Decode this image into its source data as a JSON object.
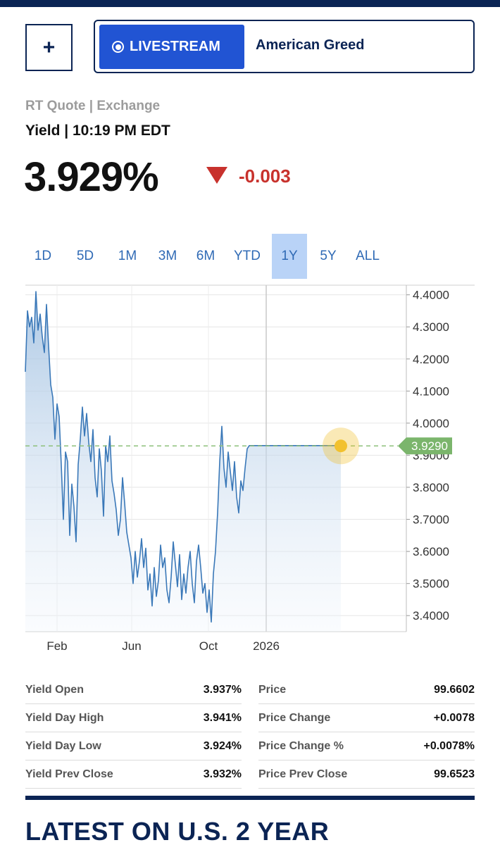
{
  "header": {
    "plus_label": "+",
    "livestream_label": "LIVESTREAM",
    "show_name": "American Greed"
  },
  "quote": {
    "source": "RT Quote | Exchange",
    "type_time": "Yield | 10:19 PM EDT",
    "last": "3.929%",
    "change": "-0.003",
    "direction": "down",
    "down_color": "#c8322d"
  },
  "tabs": [
    {
      "label": "1D",
      "active": false
    },
    {
      "label": "5D",
      "active": false
    },
    {
      "label": "1M",
      "active": false
    },
    {
      "label": "3M",
      "active": false
    },
    {
      "label": "6M",
      "active": false
    },
    {
      "label": "YTD",
      "active": false
    },
    {
      "label": "1Y",
      "active": true
    },
    {
      "label": "5Y",
      "active": false
    },
    {
      "label": "ALL",
      "active": false
    }
  ],
  "chart_data": {
    "type": "area",
    "x_tick_labels": [
      "Feb",
      "Jun",
      "Oct",
      "2026"
    ],
    "y_tick_labels": [
      "4.4000",
      "4.3000",
      "4.2000",
      "4.1000",
      "4.0000",
      "3.9000",
      "3.8000",
      "3.7000",
      "3.6000",
      "3.5000",
      "3.4000"
    ],
    "ylim": [
      3.35,
      4.43
    ],
    "current_marker_label": "3.9290",
    "current_value": 3.929,
    "line_color": "#3a78b8",
    "marker_color": "#f2c12e",
    "marker_label_color": "#7bb56c",
    "x": [
      0,
      3,
      6,
      9,
      12,
      15,
      18,
      21,
      24,
      27,
      30,
      33,
      36,
      39,
      42,
      45,
      48,
      51,
      54,
      57,
      60,
      63,
      66,
      69,
      72,
      75,
      78,
      81,
      84,
      87,
      90,
      93,
      96,
      99,
      102,
      105,
      108,
      111,
      114,
      117,
      120,
      123,
      126,
      129,
      132,
      135,
      138,
      141,
      144,
      147,
      150,
      153,
      156,
      159,
      162,
      165,
      168,
      171,
      174,
      177,
      180,
      183,
      186,
      189,
      192,
      195,
      198,
      201,
      204,
      207,
      210,
      213,
      216,
      219,
      222,
      225,
      228,
      231,
      234,
      237,
      240,
      243,
      246,
      249,
      252,
      255,
      258,
      261,
      264,
      267,
      270,
      273,
      276,
      279,
      282,
      285,
      288,
      291,
      294,
      297,
      300,
      303,
      306,
      309,
      312,
      315,
      318,
      321,
      324,
      327,
      330,
      333,
      336,
      339,
      342,
      345,
      348,
      351,
      354,
      357,
      360,
      363,
      366,
      369,
      372,
      375,
      378,
      381,
      384,
      387,
      390,
      393,
      396,
      399,
      402,
      405,
      408,
      411,
      414,
      417,
      420,
      423,
      426,
      429,
      432,
      435,
      438,
      441,
      444,
      447
    ],
    "values": [
      4.16,
      4.35,
      4.3,
      4.33,
      4.25,
      4.41,
      4.29,
      4.34,
      4.27,
      4.22,
      4.37,
      4.24,
      4.12,
      4.08,
      3.95,
      4.06,
      4.02,
      3.87,
      3.7,
      3.91,
      3.88,
      3.65,
      3.81,
      3.74,
      3.63,
      3.87,
      3.95,
      4.05,
      3.96,
      4.03,
      3.94,
      3.88,
      3.98,
      3.83,
      3.77,
      3.92,
      3.85,
      3.71,
      3.93,
      3.88,
      3.96,
      3.82,
      3.78,
      3.73,
      3.65,
      3.7,
      3.83,
      3.75,
      3.66,
      3.62,
      3.58,
      3.5,
      3.6,
      3.52,
      3.57,
      3.64,
      3.55,
      3.61,
      3.48,
      3.53,
      3.43,
      3.55,
      3.46,
      3.51,
      3.62,
      3.55,
      3.58,
      3.48,
      3.44,
      3.52,
      3.63,
      3.56,
      3.49,
      3.59,
      3.45,
      3.53,
      3.47,
      3.55,
      3.6,
      3.5,
      3.44,
      3.57,
      3.62,
      3.55,
      3.47,
      3.5,
      3.41,
      3.48,
      3.38,
      3.53,
      3.6,
      3.72,
      3.88,
      3.99,
      3.86,
      3.8,
      3.91,
      3.85,
      3.79,
      3.88,
      3.77,
      3.72,
      3.82,
      3.79,
      3.86,
      3.92,
      3.93,
      3.93,
      3.93,
      3.93,
      3.93,
      3.93,
      3.93,
      3.93,
      3.93,
      3.93,
      3.93,
      3.93,
      3.93,
      3.93,
      3.93,
      3.93,
      3.93,
      3.93,
      3.93,
      3.93,
      3.93,
      3.93,
      3.93,
      3.93,
      3.93,
      3.93,
      3.93,
      3.93,
      3.93,
      3.93,
      3.93,
      3.93,
      3.93,
      3.93,
      3.93,
      3.93,
      3.93,
      3.93,
      3.93,
      3.93,
      3.93,
      3.93,
      3.93,
      3.93
    ]
  },
  "stats": {
    "left": [
      {
        "label": "Yield Open",
        "value": "3.937%"
      },
      {
        "label": "Yield Day High",
        "value": "3.941%"
      },
      {
        "label": "Yield Day Low",
        "value": "3.924%"
      },
      {
        "label": "Yield Prev Close",
        "value": "3.932%"
      }
    ],
    "right": [
      {
        "label": "Price",
        "value": "99.6602"
      },
      {
        "label": "Price Change",
        "value": "+0.0078"
      },
      {
        "label": "Price Change %",
        "value": "+0.0078%"
      },
      {
        "label": "Price Prev Close",
        "value": "99.6523"
      }
    ]
  },
  "section": {
    "latest_heading": "LATEST ON U.S. 2 YEAR"
  }
}
